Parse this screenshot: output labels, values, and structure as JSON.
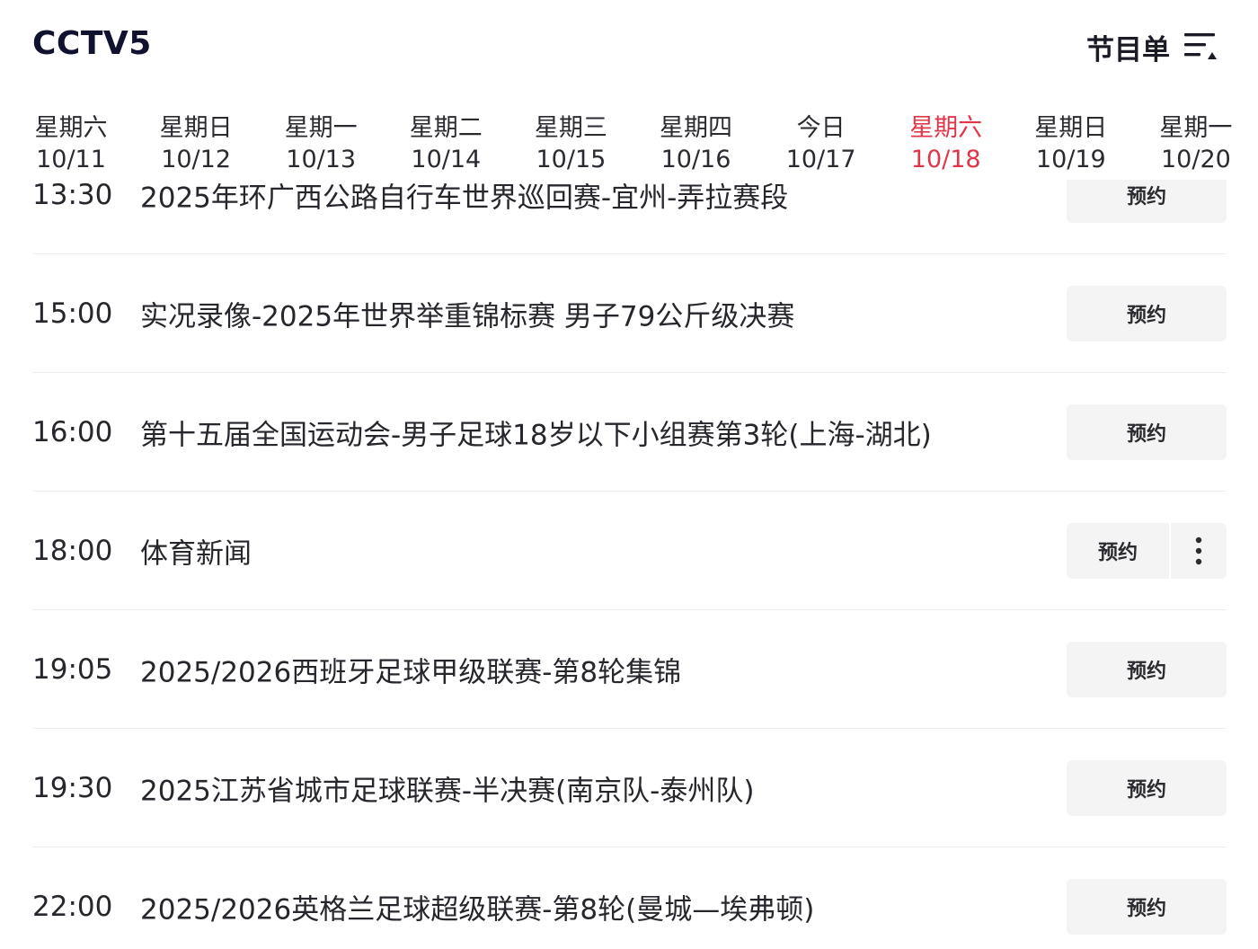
{
  "header": {
    "title": "CCTV5",
    "schedule_label": "节目单",
    "menu_icon": "list-filter-icon"
  },
  "dates": [
    {
      "weekday": "星期六",
      "date": "10/11",
      "active": false
    },
    {
      "weekday": "星期日",
      "date": "10/12",
      "active": false
    },
    {
      "weekday": "星期一",
      "date": "10/13",
      "active": false
    },
    {
      "weekday": "星期二",
      "date": "10/14",
      "active": false
    },
    {
      "weekday": "星期三",
      "date": "10/15",
      "active": false
    },
    {
      "weekday": "星期四",
      "date": "10/16",
      "active": false
    },
    {
      "weekday": "今日",
      "date": "10/17",
      "active": false
    },
    {
      "weekday": "星期六",
      "date": "10/18",
      "active": true
    },
    {
      "weekday": "星期日",
      "date": "10/19",
      "active": false
    },
    {
      "weekday": "星期一",
      "date": "10/20",
      "active": false
    }
  ],
  "colors": {
    "accent": "#e0364a",
    "title": "#10122e",
    "text": "#26262c",
    "button_bg": "#f4f4f5",
    "divider": "#ececee"
  },
  "programs": [
    {
      "time": "13:30",
      "title": "2025年环广西公路自行车世界巡回赛-宜州-弄拉赛段",
      "button": "预约",
      "has_more": false
    },
    {
      "time": "15:00",
      "title": "实况录像-2025年世界举重锦标赛 男子79公斤级决赛",
      "button": "预约",
      "has_more": false
    },
    {
      "time": "16:00",
      "title": "第十五届全国运动会-男子足球18岁以下小组赛第3轮(上海-湖北)",
      "button": "预约",
      "has_more": false
    },
    {
      "time": "18:00",
      "title": "体育新闻",
      "button": "预约",
      "has_more": true,
      "more_icon": "more-vertical-icon"
    },
    {
      "time": "19:05",
      "title": "2025/2026西班牙足球甲级联赛-第8轮集锦",
      "button": "预约",
      "has_more": false
    },
    {
      "time": "19:30",
      "title": "2025江苏省城市足球联赛-半决赛(南京队-泰州队)",
      "button": "预约",
      "has_more": false
    },
    {
      "time": "22:00",
      "title": "2025/2026英格兰足球超级联赛-第8轮(曼城—埃弗顿)",
      "button": "预约",
      "has_more": false
    }
  ]
}
